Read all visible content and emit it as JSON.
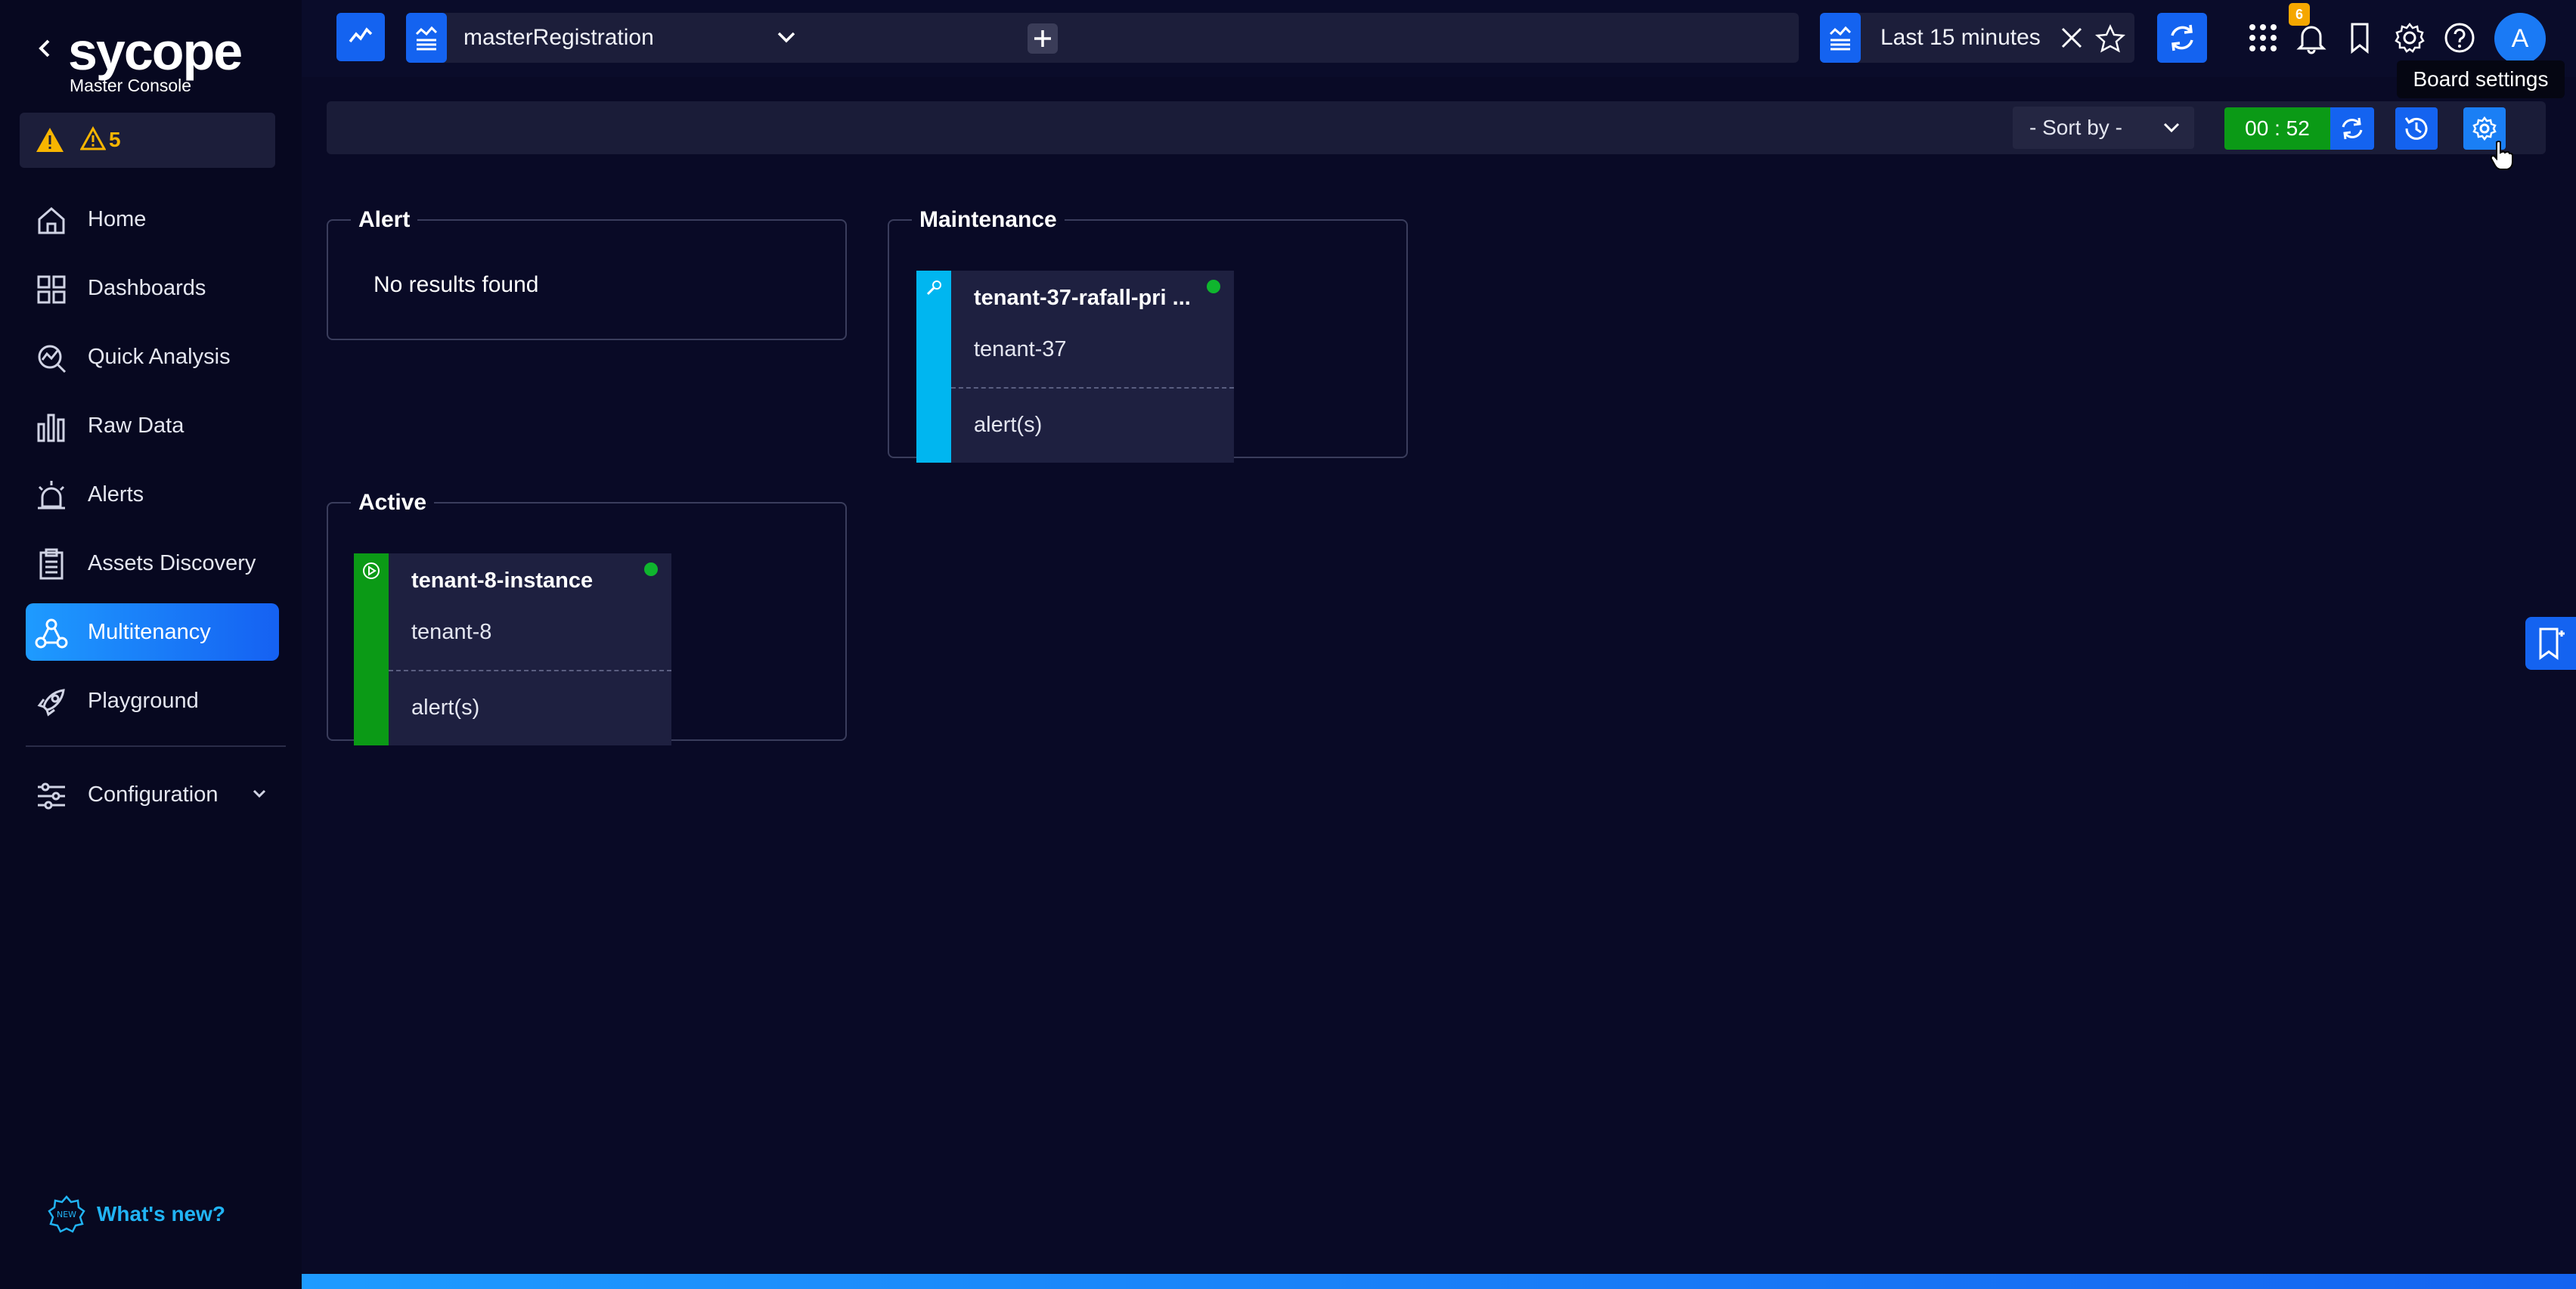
{
  "sidebar": {
    "logo_text": "sycope",
    "logo_subtitle": "Master Console",
    "alert_count": "5",
    "nav_items": [
      {
        "label": "Home",
        "icon": "home-icon"
      },
      {
        "label": "Dashboards",
        "icon": "dashboards-icon"
      },
      {
        "label": "Quick Analysis",
        "icon": "quick-analysis-icon"
      },
      {
        "label": "Raw Data",
        "icon": "raw-data-icon"
      },
      {
        "label": "Alerts",
        "icon": "alarm-icon"
      },
      {
        "label": "Assets Discovery",
        "icon": "clipboard-icon"
      },
      {
        "label": "Multitenancy",
        "icon": "multitenancy-icon",
        "active": true
      },
      {
        "label": "Playground",
        "icon": "rocket-icon"
      }
    ],
    "configuration_label": "Configuration",
    "whats_new_label": "What's new?"
  },
  "topbar": {
    "dashboard_name": "masterRegistration",
    "time_range": "Last 15 minutes",
    "notification_count": "6",
    "avatar_letter": "A",
    "tooltip": "Board settings"
  },
  "board_toolbar": {
    "sort_label": "- Sort by -",
    "timer": "00 : 52"
  },
  "groups": {
    "alert": {
      "title": "Alert",
      "empty_message": "No results found"
    },
    "maintenance": {
      "title": "Maintenance",
      "card": {
        "title": "tenant-37-rafall-pri ...",
        "tenant": "tenant-37",
        "alerts": "alert(s)",
        "stripe_color": "#00b6f0",
        "status_color": "#0fb52e"
      }
    },
    "active": {
      "title": "Active",
      "card": {
        "title": "tenant-8-instance",
        "tenant": "tenant-8",
        "alerts": "alert(s)",
        "stripe_color": "#0b9a16",
        "status_color": "#0fb52e"
      }
    }
  },
  "colors": {
    "background": "#090a26",
    "accent": "#1463f0",
    "active_nav": "#1e9bff",
    "warning": "#f7b500"
  }
}
